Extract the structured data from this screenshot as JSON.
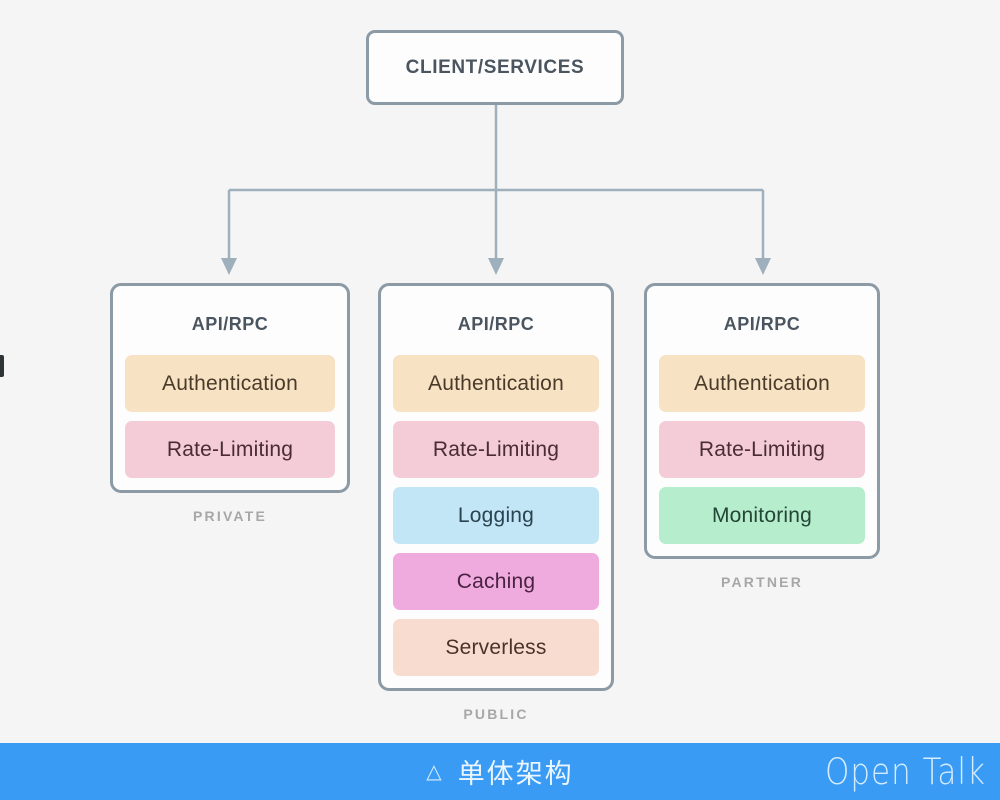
{
  "diagram": {
    "root": {
      "label": "CLIENT/SERVICES"
    },
    "columns": [
      {
        "key": "private",
        "title": "API/RPC",
        "caption": "PRIVATE",
        "bands": [
          {
            "label": "Authentication",
            "bg": "#f7e2c3",
            "fg": "#4a3a2a"
          },
          {
            "label": "Rate-Limiting",
            "bg": "#f3ccd8",
            "fg": "#4a2b36"
          }
        ]
      },
      {
        "key": "public",
        "title": "API/RPC",
        "caption": "PUBLIC",
        "bands": [
          {
            "label": "Authentication",
            "bg": "#f7e2c3",
            "fg": "#4a3a2a"
          },
          {
            "label": "Rate-Limiting",
            "bg": "#f3ccd8",
            "fg": "#4a2b36"
          },
          {
            "label": "Logging",
            "bg": "#c3e6f7",
            "fg": "#2a4350"
          },
          {
            "label": "Caching",
            "bg": "#efaade",
            "fg": "#4a2242"
          },
          {
            "label": "Serverless",
            "bg": "#f9dcd0",
            "fg": "#4a332a"
          }
        ]
      },
      {
        "key": "partner",
        "title": "API/RPC",
        "caption": "PARTNER",
        "bands": [
          {
            "label": "Authentication",
            "bg": "#f7e2c3",
            "fg": "#4a3a2a"
          },
          {
            "label": "Rate-Limiting",
            "bg": "#f3ccd8",
            "fg": "#4a2b36"
          },
          {
            "label": "Monitoring",
            "bg": "#b5edcd",
            "fg": "#234536"
          }
        ]
      }
    ],
    "connector_color": "#9fb0bd"
  },
  "bottom_bar": {
    "marker_icon": "triangle-outline-icon",
    "marker_glyph": "△",
    "title": "单体架构",
    "brand": "Open Talk",
    "background": "#3a9bf4"
  },
  "canvas": {
    "background": "#f5f5f5"
  }
}
